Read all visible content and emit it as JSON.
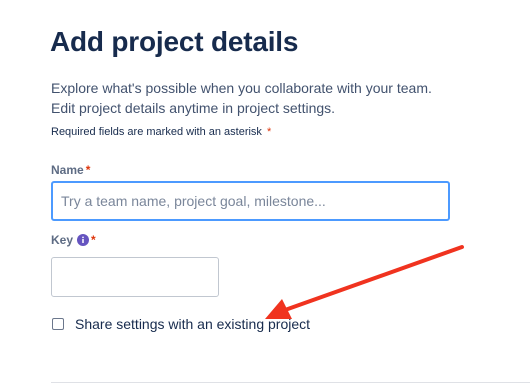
{
  "header": {
    "title": "Add project details"
  },
  "description": {
    "line1": "Explore what's possible when you collaborate with your team.",
    "line2": "Edit project details anytime in project settings."
  },
  "required_note": {
    "text": "Required fields are marked with an asterisk",
    "asterisk": "*"
  },
  "fields": {
    "name": {
      "label": "Name",
      "required_marker": "*",
      "value": "",
      "placeholder": "Try a team name, project goal, milestone..."
    },
    "key": {
      "label": "Key",
      "required_marker": "*",
      "value": "",
      "placeholder": "",
      "info_icon": "info-icon"
    }
  },
  "share_settings": {
    "label": "Share settings with an existing project",
    "checked": false
  },
  "colors": {
    "title": "#172b4d",
    "asterisk": "#de350b",
    "focus_border": "#4c9aff",
    "info_icon": "#6554c0",
    "annotation_arrow": "#f0331f"
  },
  "annotation": {
    "type": "arrow",
    "points_to": "share-settings-checkbox-label"
  }
}
